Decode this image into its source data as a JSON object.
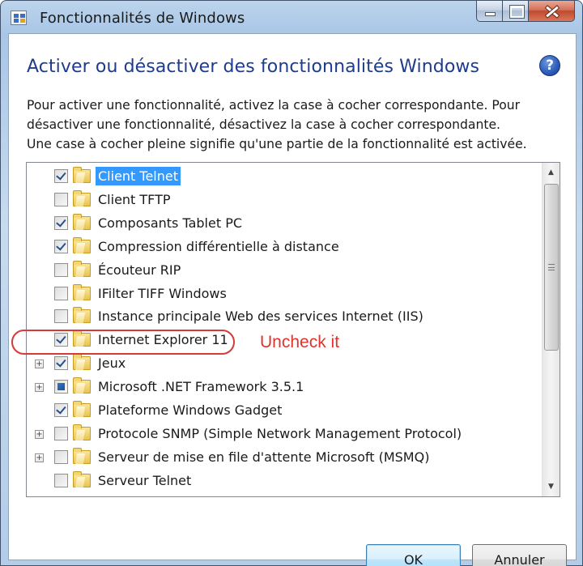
{
  "window": {
    "title": "Fonctionnalités de Windows"
  },
  "header": {
    "title": "Activer ou désactiver des fonctionnalités Windows",
    "help_label": "?",
    "description": "Pour activer une fonctionnalité, activez la case à cocher correspondante. Pour\ndésactiver une fonctionnalité, désactivez la case à cocher correspondante.\nUne case à cocher pleine signifie qu'une partie de la fonctionnalité est activée."
  },
  "features": [
    {
      "label": "Client Telnet",
      "state": "checked",
      "expandable": false,
      "selected": true
    },
    {
      "label": "Client TFTP",
      "state": "unchecked",
      "expandable": false,
      "selected": false
    },
    {
      "label": "Composants Tablet PC",
      "state": "checked",
      "expandable": false,
      "selected": false
    },
    {
      "label": "Compression différentielle à distance",
      "state": "checked",
      "expandable": false,
      "selected": false
    },
    {
      "label": "Écouteur RIP",
      "state": "unchecked",
      "expandable": false,
      "selected": false
    },
    {
      "label": "IFilter TIFF Windows",
      "state": "unchecked",
      "expandable": false,
      "selected": false
    },
    {
      "label": "Instance principale Web des services Internet (IIS)",
      "state": "unchecked",
      "expandable": false,
      "selected": false
    },
    {
      "label": "Internet Explorer 11",
      "state": "checked",
      "expandable": false,
      "selected": false
    },
    {
      "label": "Jeux",
      "state": "checked",
      "expandable": true,
      "selected": false
    },
    {
      "label": "Microsoft .NET Framework 3.5.1",
      "state": "partial",
      "expandable": true,
      "selected": false
    },
    {
      "label": "Plateforme Windows Gadget",
      "state": "checked",
      "expandable": false,
      "selected": false
    },
    {
      "label": "Protocole SNMP (Simple Network Management Protocol)",
      "state": "unchecked",
      "expandable": true,
      "selected": false
    },
    {
      "label": "Serveur de mise en file d'attente Microsoft (MSMQ)",
      "state": "unchecked",
      "expandable": true,
      "selected": false
    },
    {
      "label": "Serveur Telnet",
      "state": "unchecked",
      "expandable": false,
      "selected": false
    }
  ],
  "annotation": {
    "text": "Uncheck it",
    "color": "#e0332b"
  },
  "buttons": {
    "ok_label": "OK",
    "cancel_label": "Annuler"
  },
  "colors": {
    "accent": "#1e3c8c",
    "selection": "#3399ff"
  }
}
